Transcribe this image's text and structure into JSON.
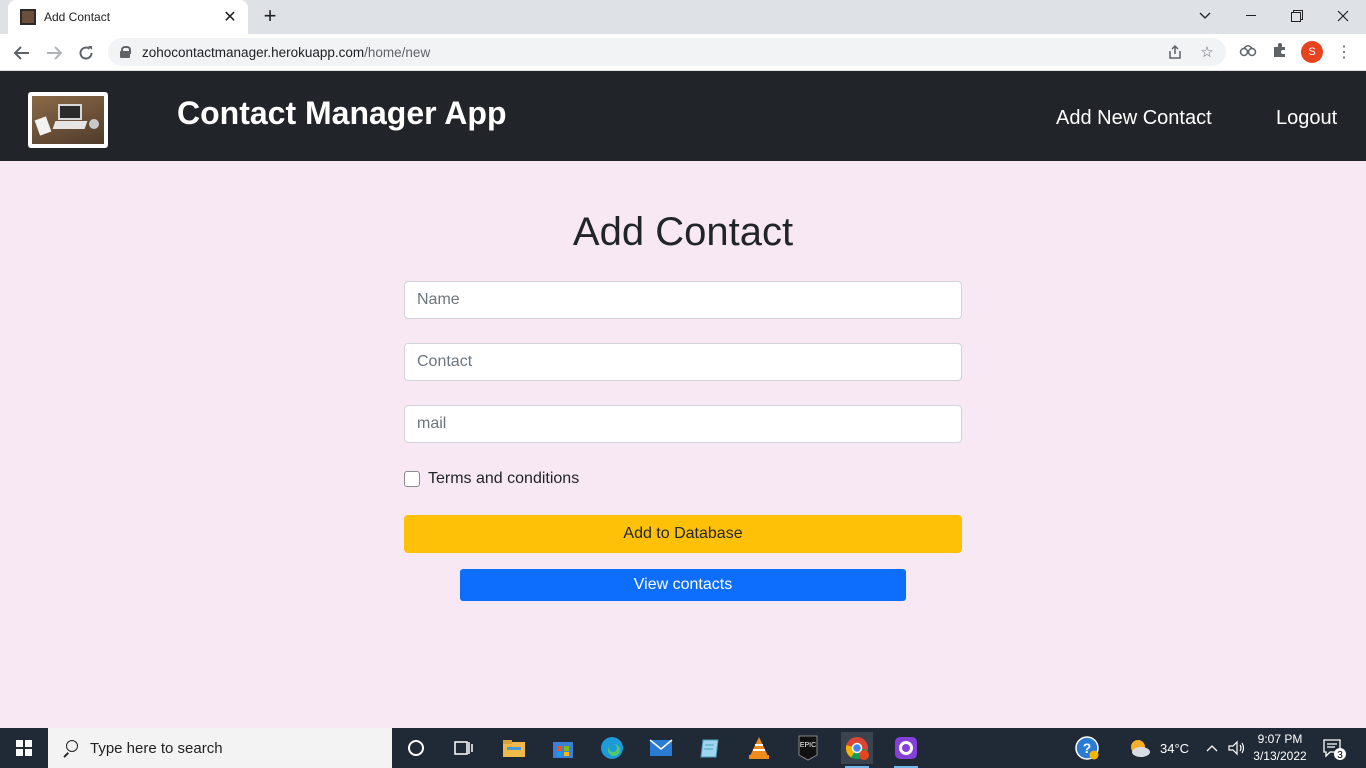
{
  "browser": {
    "tab_title": "Add Contact",
    "url_host": "zohocontactmanager.herokuapp.com",
    "url_path": "/home/new",
    "profile_initial": "S"
  },
  "navbar": {
    "brand": "Contact Manager App",
    "links": [
      "Add New Contact",
      "Logout"
    ]
  },
  "form": {
    "title": "Add Contact",
    "name_placeholder": "Name",
    "contact_placeholder": "Contact",
    "mail_placeholder": "mail",
    "terms_label": "Terms and conditions",
    "terms_checked": false,
    "submit_label": "Add to Database",
    "view_label": "View contacts"
  },
  "colors": {
    "navbar_bg": "#212529",
    "page_bg": "#f8e8f3",
    "submit_bg": "#ffc107",
    "view_bg": "#0d6efd"
  },
  "taskbar": {
    "search_placeholder": "Type here to search",
    "weather": "34°C",
    "time": "9:07 PM",
    "date": "3/13/2022",
    "notification_count": "3",
    "apps": [
      "cortana-icon",
      "task-view-icon",
      "file-explorer-icon",
      "ms-store-icon",
      "edge-icon",
      "mail-icon",
      "notepad-icon",
      "vlc-icon",
      "epic-games-icon",
      "chrome-icon",
      "github-desktop-icon"
    ]
  }
}
